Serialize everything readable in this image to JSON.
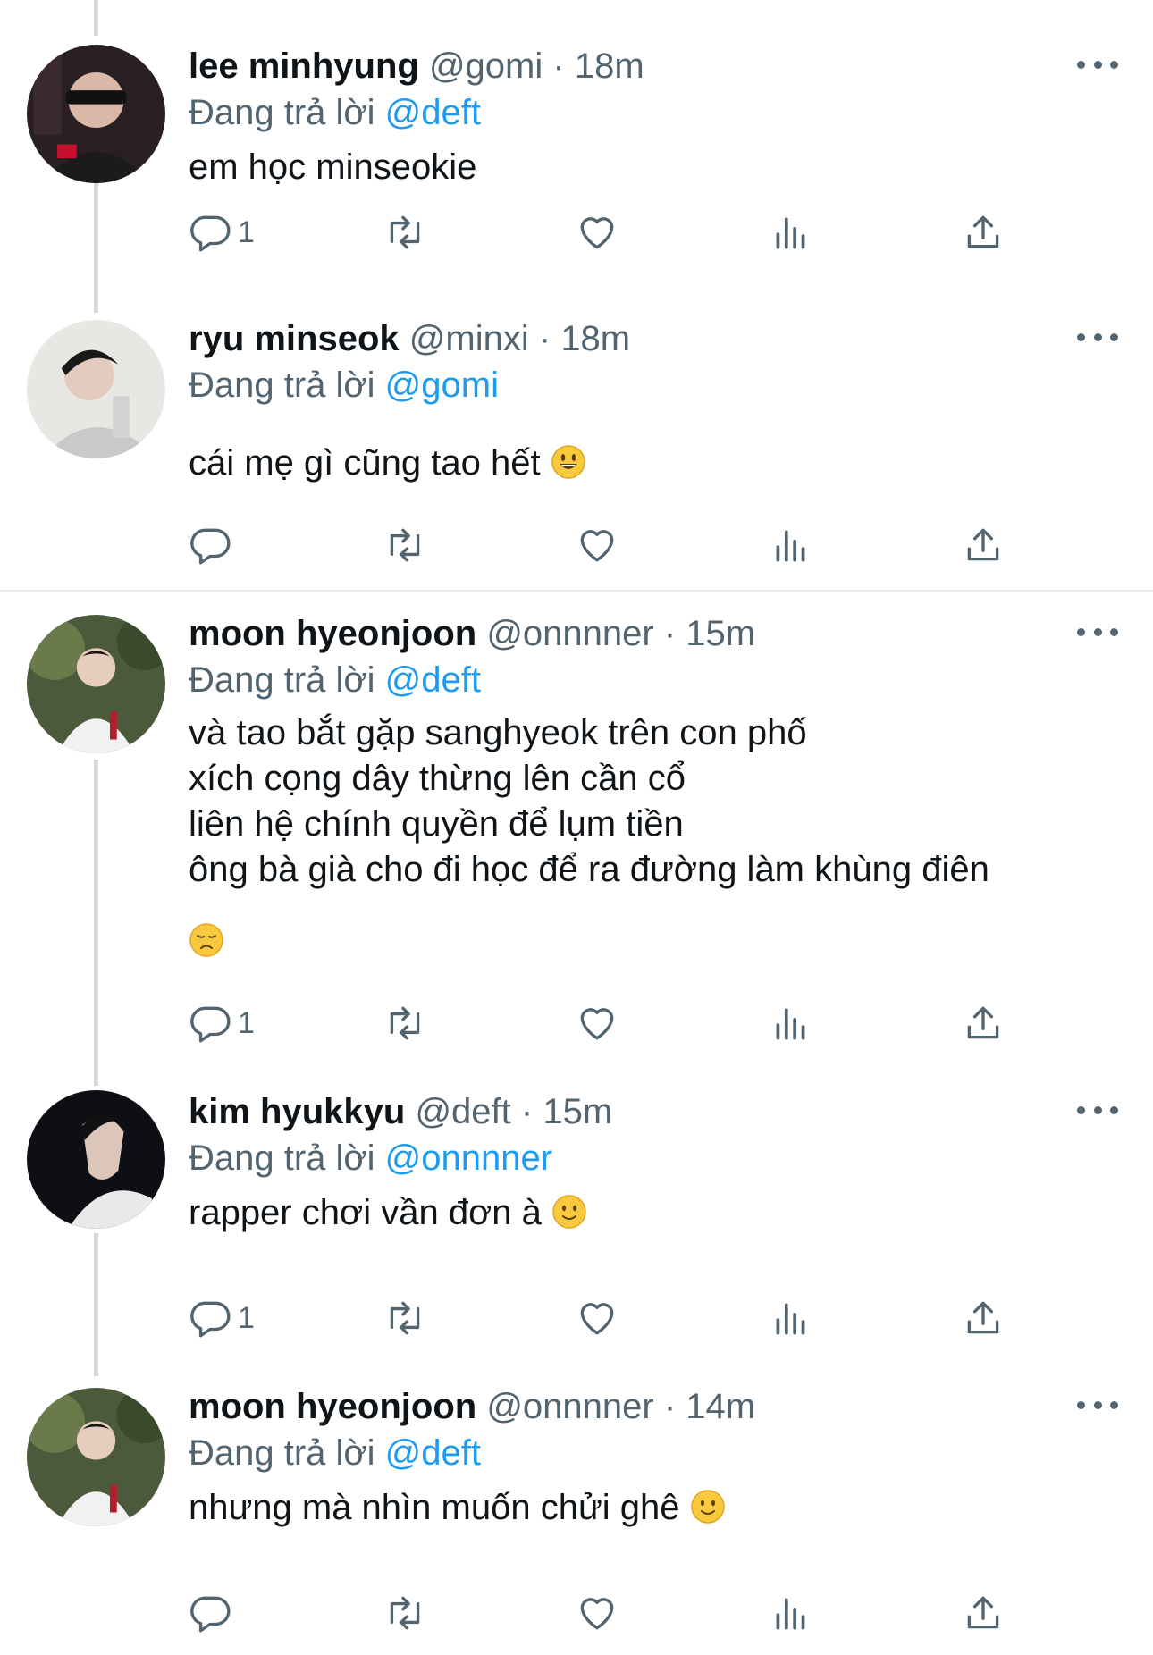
{
  "tweets": [
    {
      "name": "lee minhyung",
      "handle": "@gomi",
      "sep": "·",
      "time": "18m",
      "reply_prefix": "Đang trả lời",
      "reply_handle": "@deft",
      "text": "em học minseokie",
      "emoji": "",
      "reply_count": "1"
    },
    {
      "name": "ryu minseok",
      "handle": "@minxi",
      "sep": "·",
      "time": "18m",
      "reply_prefix": "Đang trả lời",
      "reply_handle": "@gomi",
      "text": "cái mẹ gì cũng tao hết",
      "emoji": "grinning-face",
      "reply_count": ""
    },
    {
      "name": "moon hyeonjoon",
      "handle": "@onnnner",
      "sep": "·",
      "time": "15m",
      "reply_prefix": "Đang trả lời",
      "reply_handle": "@deft",
      "text": "và tao bắt gặp sanghyeok trên con phố\nxích cọng dây thừng lên cần cổ\nliên hệ chính quyền để lụm tiền\nông bà già cho đi học để ra đường làm khùng điên",
      "emoji": "disappointed-face",
      "reply_count": "1"
    },
    {
      "name": "kim hyukkyu",
      "handle": "@deft",
      "sep": "·",
      "time": "15m",
      "reply_prefix": "Đang trả lời",
      "reply_handle": "@onnnner",
      "text": "rapper chơi vần đơn à",
      "emoji": "slightly-smiling-face",
      "reply_count": "1"
    },
    {
      "name": "moon hyeonjoon",
      "handle": "@onnnner",
      "sep": "·",
      "time": "14m",
      "reply_prefix": "Đang trả lời",
      "reply_handle": "@deft",
      "text": "nhưng mà nhìn muốn chửi ghê",
      "emoji": "slightly-smiling-face",
      "reply_count": ""
    }
  ],
  "icons": {
    "reply": "reply-icon",
    "retweet": "retweet-icon",
    "like": "heart-icon",
    "views": "views-icon",
    "share": "share-icon",
    "more": "more-icon"
  },
  "colors": {
    "link": "#1d9bf0",
    "secondary": "#536471",
    "text": "#0f1419",
    "thread_line": "#cfd9de"
  }
}
